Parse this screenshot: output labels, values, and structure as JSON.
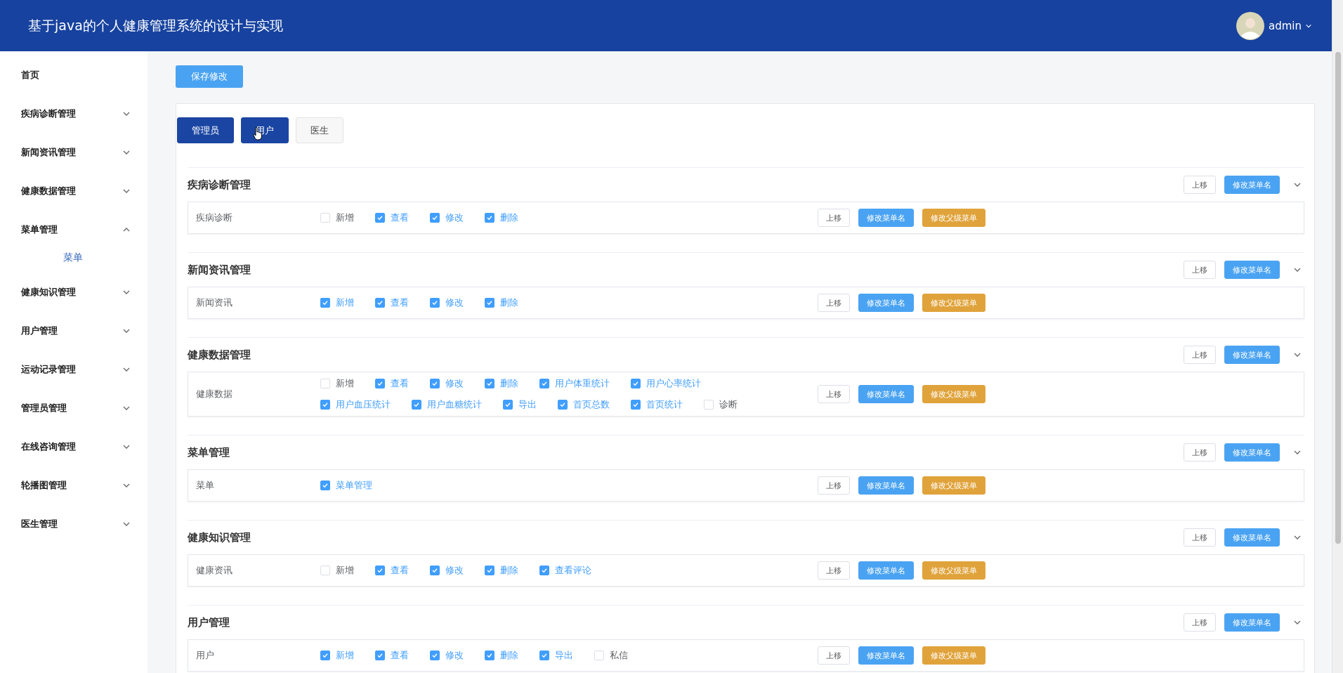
{
  "header": {
    "title": "基于java的个人健康管理系统的设计与实现",
    "user": "admin"
  },
  "sidebar": {
    "items": [
      {
        "kind": "link",
        "label": "首页"
      },
      {
        "kind": "submenu",
        "label": "疾病诊断管理",
        "expanded": false
      },
      {
        "kind": "submenu",
        "label": "新闻资讯管理",
        "expanded": false
      },
      {
        "kind": "submenu",
        "label": "健康数据管理",
        "expanded": false
      },
      {
        "kind": "submenu",
        "label": "菜单管理",
        "expanded": true,
        "children": [
          {
            "label": "菜单"
          }
        ]
      },
      {
        "kind": "submenu",
        "label": "健康知识管理",
        "expanded": false
      },
      {
        "kind": "submenu",
        "label": "用户管理",
        "expanded": false
      },
      {
        "kind": "submenu",
        "label": "运动记录管理",
        "expanded": false
      },
      {
        "kind": "submenu",
        "label": "管理员管理",
        "expanded": false
      },
      {
        "kind": "submenu",
        "label": "在线咨询管理",
        "expanded": false
      },
      {
        "kind": "submenu",
        "label": "轮播图管理",
        "expanded": false
      },
      {
        "kind": "submenu",
        "label": "医生管理",
        "expanded": false
      }
    ]
  },
  "save_button": "保存修改",
  "tabs": [
    {
      "label": "管理员",
      "selected": true,
      "pointer_over": false
    },
    {
      "label": "用户",
      "selected": true,
      "pointer_over": true
    },
    {
      "label": "医生",
      "selected": false,
      "pointer_over": false
    }
  ],
  "sections": [
    {
      "title": "疾病诊断管理",
      "move_up": "上移",
      "rename": "修改菜单名",
      "rows": [
        {
          "label": "疾病诊断",
          "move_up": "上移",
          "rename": "修改菜单名",
          "change_parent": "修改父级菜单",
          "permissions": [
            {
              "label": "新增",
              "checked": false
            },
            {
              "label": "查看",
              "checked": true
            },
            {
              "label": "修改",
              "checked": true
            },
            {
              "label": "删除",
              "checked": true
            }
          ]
        }
      ]
    },
    {
      "title": "新闻资讯管理",
      "move_up": "上移",
      "rename": "修改菜单名",
      "rows": [
        {
          "label": "新闻资讯",
          "move_up": "上移",
          "rename": "修改菜单名",
          "change_parent": "修改父级菜单",
          "permissions": [
            {
              "label": "新增",
              "checked": true
            },
            {
              "label": "查看",
              "checked": true
            },
            {
              "label": "修改",
              "checked": true
            },
            {
              "label": "删除",
              "checked": true
            }
          ]
        }
      ]
    },
    {
      "title": "健康数据管理",
      "move_up": "上移",
      "rename": "修改菜单名",
      "rows": [
        {
          "label": "健康数据",
          "move_up": "上移",
          "rename": "修改菜单名",
          "change_parent": "修改父级菜单",
          "permissions": [
            {
              "label": "新增",
              "checked": false
            },
            {
              "label": "查看",
              "checked": true
            },
            {
              "label": "修改",
              "checked": true
            },
            {
              "label": "删除",
              "checked": true
            },
            {
              "label": "用户体重统计",
              "checked": true
            },
            {
              "label": "用户心率统计",
              "checked": true
            },
            {
              "label": "用户血压统计",
              "checked": true
            },
            {
              "label": "用户血糖统计",
              "checked": true
            },
            {
              "label": "导出",
              "checked": true
            },
            {
              "label": "首页总数",
              "checked": true
            },
            {
              "label": "首页统计",
              "checked": true
            },
            {
              "label": "诊断",
              "checked": false
            }
          ]
        }
      ]
    },
    {
      "title": "菜单管理",
      "move_up": "上移",
      "rename": "修改菜单名",
      "rows": [
        {
          "label": "菜单",
          "move_up": "上移",
          "rename": "修改菜单名",
          "change_parent": "修改父级菜单",
          "permissions": [
            {
              "label": "菜单管理",
              "checked": true
            }
          ]
        }
      ]
    },
    {
      "title": "健康知识管理",
      "move_up": "上移",
      "rename": "修改菜单名",
      "rows": [
        {
          "label": "健康资讯",
          "move_up": "上移",
          "rename": "修改菜单名",
          "change_parent": "修改父级菜单",
          "permissions": [
            {
              "label": "新增",
              "checked": false
            },
            {
              "label": "查看",
              "checked": true
            },
            {
              "label": "修改",
              "checked": true
            },
            {
              "label": "删除",
              "checked": true
            },
            {
              "label": "查看评论",
              "checked": true
            }
          ]
        }
      ]
    },
    {
      "title": "用户管理",
      "move_up": "上移",
      "rename": "修改菜单名",
      "rows": [
        {
          "label": "用户",
          "move_up": "上移",
          "rename": "修改菜单名",
          "change_parent": "修改父级菜单",
          "permissions": [
            {
              "label": "新增",
              "checked": true
            },
            {
              "label": "查看",
              "checked": true
            },
            {
              "label": "修改",
              "checked": true
            },
            {
              "label": "删除",
              "checked": true
            },
            {
              "label": "导出",
              "checked": true
            },
            {
              "label": "私信",
              "checked": false
            }
          ]
        }
      ]
    }
  ]
}
